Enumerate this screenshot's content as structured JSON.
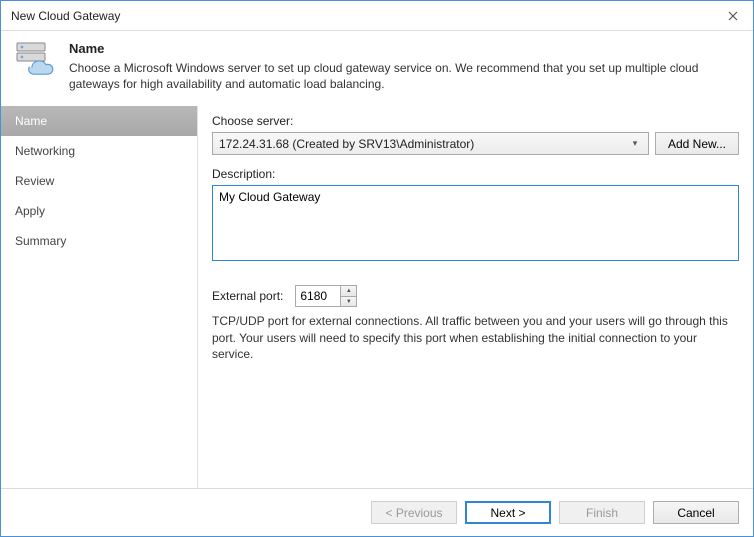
{
  "window": {
    "title": "New Cloud Gateway"
  },
  "header": {
    "title": "Name",
    "subtitle": "Choose a Microsoft Windows server to set up cloud gateway service on. We recommend that you set up multiple cloud gateways for high availability and automatic load balancing."
  },
  "sidebar": {
    "steps": [
      {
        "label": "Name",
        "active": true
      },
      {
        "label": "Networking",
        "active": false
      },
      {
        "label": "Review",
        "active": false
      },
      {
        "label": "Apply",
        "active": false
      },
      {
        "label": "Summary",
        "active": false
      }
    ]
  },
  "content": {
    "choose_server_label": "Choose server:",
    "server_selected": "172.24.31.68 (Created by SRV13\\Administrator)",
    "add_new_label": "Add New...",
    "description_label": "Description:",
    "description_value": "My Cloud Gateway",
    "external_port_label": "External port:",
    "external_port_value": "6180",
    "port_hint": "TCP/UDP port for external connections. All traffic between you and your users will go through this port. Your users will need to specify this port when establishing the initial connection to your service."
  },
  "footer": {
    "previous_label": "< Previous",
    "next_label": "Next >",
    "finish_label": "Finish",
    "cancel_label": "Cancel"
  }
}
